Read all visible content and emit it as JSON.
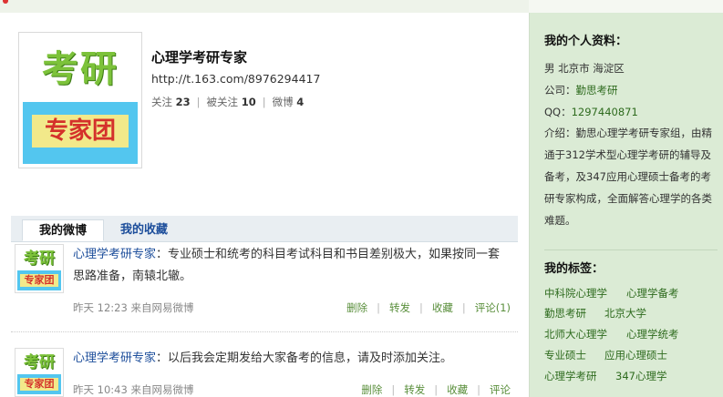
{
  "profile": {
    "logo_text_top": "考研",
    "logo_text_bottom": "专家团",
    "name": "心理学考研专家",
    "url": "http://t.163.com/8976294417",
    "stats": {
      "following_label": "关注",
      "following_count": "23",
      "followers_label": "被关注",
      "followers_count": "10",
      "posts_label": "微博",
      "posts_count": "4"
    }
  },
  "tabs": [
    {
      "label": "我的微博",
      "active": true
    },
    {
      "label": "我的收藏",
      "active": false
    }
  ],
  "posts": [
    {
      "author": "心理学考研专家",
      "text": "：专业硕士和统考的科目考试科目和书目差别极大，如果按同一套思路准备，南辕北辙。",
      "meta": "昨天 12:23 来自网易微博",
      "actions": [
        "删除",
        "转发",
        "收藏",
        "评论(1)"
      ]
    },
    {
      "author": "心理学考研专家",
      "text": "：以后我会定期发给大家备考的信息，请及时添加关注。",
      "meta": "昨天 10:43 来自网易微博",
      "actions": [
        "删除",
        "转发",
        "收藏",
        "评论"
      ]
    }
  ],
  "sidebar": {
    "profile_title": "我的个人资料：",
    "gender_location": "男  北京市 海淀区",
    "company_label": "公司：",
    "company_value": "勤思考研",
    "qq_label": "QQ：",
    "qq_value": "1297440871",
    "intro_label": "介绍：",
    "intro_value": "勤思心理学考研专家组，由精通于312学术型心理学考研的辅导及备考，及347应用心理硕士备考的考研专家构成，全面解答心理学的各类难题。",
    "tags_title": "我的标签：",
    "tags": [
      "中科院心理学",
      "心理学备考",
      "勤思考研",
      "北京大学",
      "北师大心理学",
      "心理学统考",
      "专业硕士",
      "应用心理硕士",
      "心理学考研",
      "347心理学"
    ]
  },
  "colors": {
    "link_blue": "#1d4e9b",
    "sidebar_bg": "#dbebd5",
    "tag_green": "#2e6b1e",
    "action_green": "#5a8f3c"
  }
}
